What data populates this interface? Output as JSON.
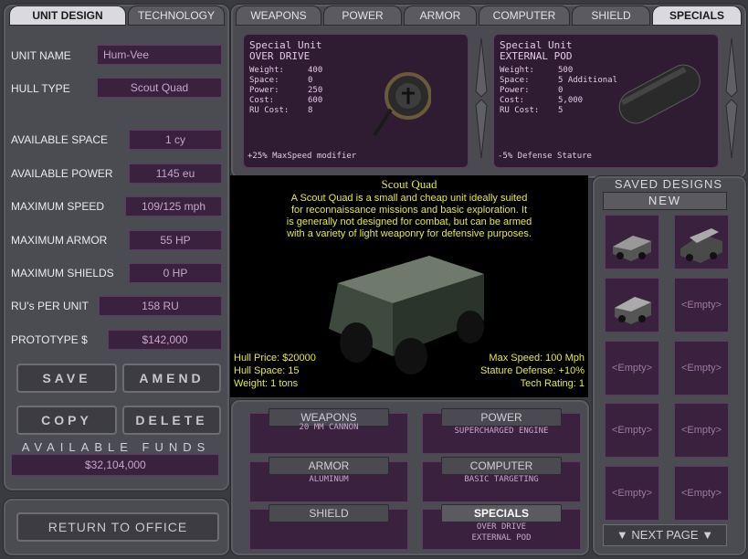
{
  "tabs_left": {
    "unit_design": "UNIT DESIGN",
    "technology": "TECHNOLOGY"
  },
  "tabs_right": [
    "WEAPONS",
    "POWER",
    "ARMOR",
    "COMPUTER",
    "SHIELD",
    "SPECIALS"
  ],
  "stats": {
    "unit_name_label": "UNIT NAME",
    "unit_name": "Hum-Vee",
    "hull_type_label": "HULL TYPE",
    "hull_type": "Scout Quad",
    "space_label": "AVAILABLE SPACE",
    "space": "1 cy",
    "power_label": "AVAILABLE POWER",
    "power": "1145 eu",
    "speed_label": "MAXIMUM SPEED",
    "speed": "109/125 mph",
    "armor_label": "MAXIMUM ARMOR",
    "armor": "55 HP",
    "shields_label": "MAXIMUM SHIELDS",
    "shields": "0 HP",
    "ru_label": "RU's PER UNIT",
    "ru": "158 RU",
    "proto_label": "PROTOTYPE $",
    "proto": "$142,000"
  },
  "buttons": {
    "save": "SAVE",
    "amend": "AMEND",
    "copy": "COPY",
    "delete": "DELETE",
    "return": "RETURN TO OFFICE"
  },
  "funds": {
    "label": "AVAILABLE FUNDS",
    "value": "$32,104,000"
  },
  "card_left": {
    "l1": "Special Unit",
    "l2": "OVER DRIVE",
    "k_weight": "Weight:",
    "v_weight": "400",
    "k_space": "Space:",
    "v_space": "0",
    "k_power": "Power:",
    "v_power": "250",
    "k_cost": "Cost:",
    "v_cost": "600",
    "k_ru": "RU Cost:",
    "v_ru": "8",
    "modifier": "+25% MaxSpeed modifier"
  },
  "card_right": {
    "l1": "Special Unit",
    "l2": "EXTERNAL POD",
    "k_weight": "Weight:",
    "v_weight": "500",
    "k_space": "Space:",
    "v_space": "5 Additional",
    "k_power": "Power:",
    "v_power": "0",
    "k_cost": "Cost:",
    "v_cost": "5,000",
    "k_ru": "RU Cost:",
    "v_ru": "5",
    "modifier": "-5% Defense Stature"
  },
  "hull": {
    "title": "Scout Quad",
    "d1": "A Scout Quad is a small and cheap unit ideally suited",
    "d2": "for reconnaissance missions and basic exploration. It",
    "d3": "is generally not designed for combat, but can be armed",
    "d4": "with a variety of light weaponry for defensive purposes.",
    "price": "Hull Price: $20000",
    "space": "Hull Space: 15",
    "weight": "Weight: 1 tons",
    "max_speed": "Max Speed: 100 Mph",
    "stature": "Stature Defense: +10%",
    "tech": "Tech Rating: 1"
  },
  "saved": {
    "title": "SAVED DESIGNS",
    "new": "NEW",
    "empty": "<Empty>",
    "next": "▼ NEXT PAGE ▼"
  },
  "components": {
    "weapons": "WEAPONS",
    "weapons_v": "20 MM CANNON",
    "power": "POWER",
    "power_v": "SUPERCHARGED ENGINE",
    "armor": "ARMOR",
    "armor_v": "ALUMINUM",
    "computer": "COMPUTER",
    "computer_v": "BASIC TARGETING",
    "shield": "SHIELD",
    "shield_v": "",
    "specials": "SPECIALS",
    "specials_v1": "OVER DRIVE",
    "specials_v2": "EXTERNAL POD"
  },
  "colors": {
    "accent": "#e4eb3a",
    "field": "#3a213e",
    "field_text": "#c8a5cc"
  }
}
